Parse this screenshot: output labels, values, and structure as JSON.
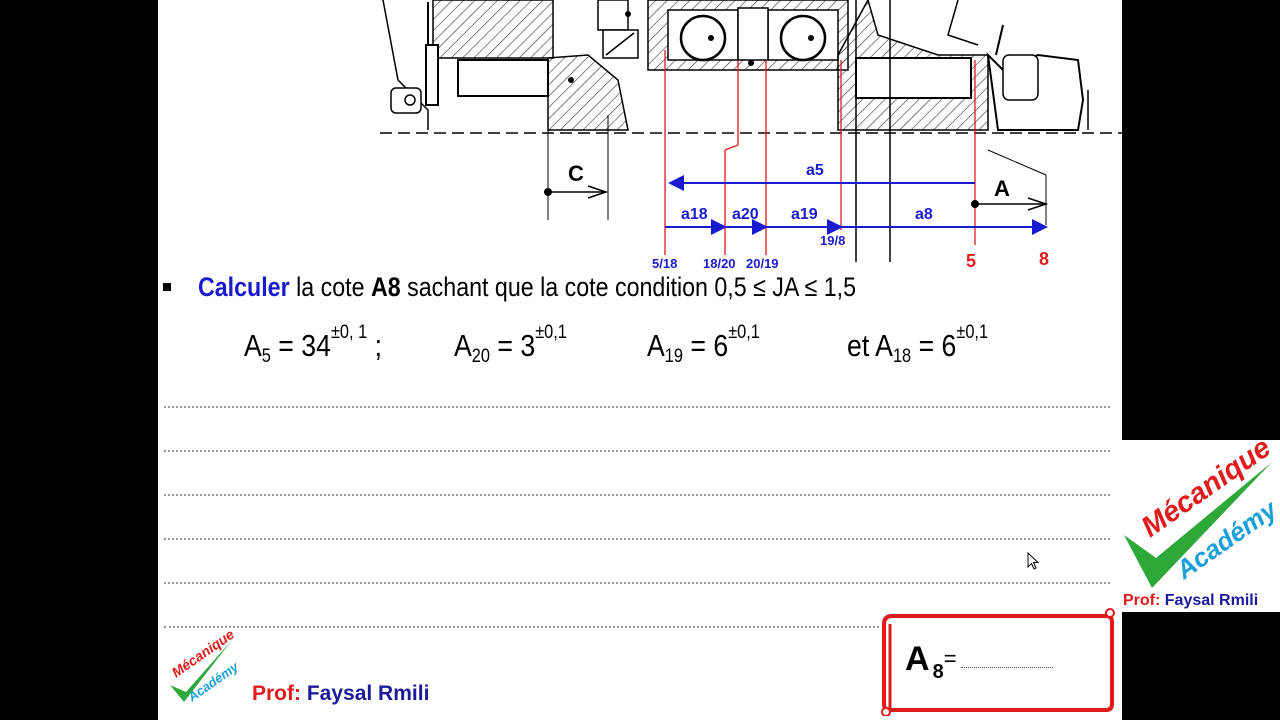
{
  "diagram": {
    "labels": {
      "c": "C",
      "a": "A",
      "a5": "a5",
      "a18": "a18",
      "a20": "a20",
      "a19": "a19",
      "a8": "a8",
      "s5_18": "5/18",
      "s18_20": "18/20",
      "s20_19": "20/19",
      "s19_8": "19/8",
      "n5": "5",
      "n8": "8"
    }
  },
  "task": {
    "verb": "Calculer",
    "part1": "la cote",
    "target": "A8",
    "part2": "sachant que la cote condition 0,5 ≤ JA ≤ 1,5"
  },
  "equations": [
    {
      "name": "A",
      "sub": "5",
      "eq": "= 34",
      "tol": "±0, 1",
      "suffix": ";"
    },
    {
      "name": "A",
      "sub": "20",
      "eq": "= 3",
      "tol": "±0,1",
      "suffix": ""
    },
    {
      "name": "A",
      "sub": "19",
      "eq": "= 6",
      "tol": "±0,1",
      "suffix": ""
    },
    {
      "name": "A",
      "sub": "18",
      "eq": "= 6",
      "tol": "±0,1",
      "prefix": "et ",
      "suffix": ""
    }
  ],
  "answer": {
    "name": "A",
    "sub": "8",
    "eq": "="
  },
  "branding": {
    "prof_label": "Prof:",
    "prof_name": "Faysal Rmili",
    "logo_word1": "Mécanique",
    "logo_word2": "Académy"
  },
  "colors": {
    "accent_blue": "#1a1ad0",
    "accent_red": "#e01b1b",
    "logo_green": "#2fa83a",
    "logo_blue": "#1aa0d8"
  }
}
